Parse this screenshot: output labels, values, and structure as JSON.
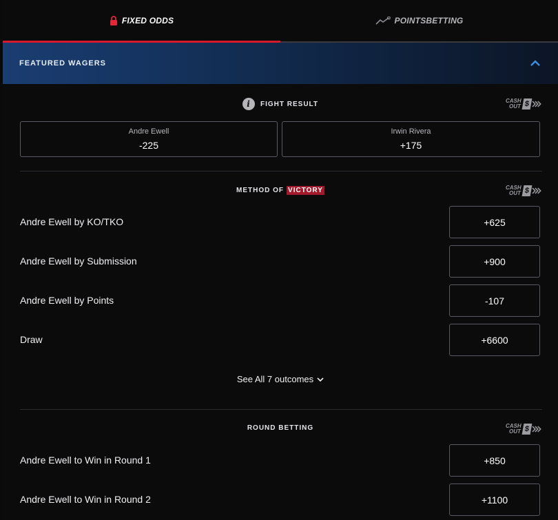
{
  "tabs": [
    {
      "label": "FIXED ODDS",
      "icon": "lock-icon",
      "active": true
    },
    {
      "label": "POINTSBETTING",
      "icon": "trend-icon",
      "active": false
    }
  ],
  "featured": {
    "title": "FEATURED WAGERS"
  },
  "fight_result": {
    "title": "FIGHT RESULT",
    "cashout": {
      "line1": "CASH",
      "line2": "OUT",
      "symbol": "$"
    },
    "options": [
      {
        "name": "Andre Ewell",
        "odds": "-225"
      },
      {
        "name": "Irwin Rivera",
        "odds": "+175"
      }
    ]
  },
  "method_of_victory": {
    "title_prefix": "METHOD OF",
    "title_highlight": "VICTORY",
    "cashout": {
      "line1": "CASH",
      "line2": "OUT",
      "symbol": "$"
    },
    "rows": [
      {
        "label": "Andre Ewell by KO/TKO",
        "odds": "+625"
      },
      {
        "label": "Andre Ewell by Submission",
        "odds": "+900"
      },
      {
        "label": "Andre Ewell by Points",
        "odds": "-107"
      },
      {
        "label": "Draw",
        "odds": "+6600"
      }
    ],
    "see_all": "See All 7 outcomes"
  },
  "round_betting": {
    "title": "ROUND BETTING",
    "cashout": {
      "line1": "CASH",
      "line2": "OUT",
      "symbol": "$"
    },
    "rows": [
      {
        "label": "Andre Ewell to Win in Round 1",
        "odds": "+850"
      },
      {
        "label": "Andre Ewell to Win in Round 2",
        "odds": "+1100"
      }
    ]
  },
  "colors": {
    "accent_red": "#d7192b",
    "highlight_red": "#a1192a",
    "featured_blue": "#1a3d72",
    "chevron_blue": "#3d8fe0"
  }
}
